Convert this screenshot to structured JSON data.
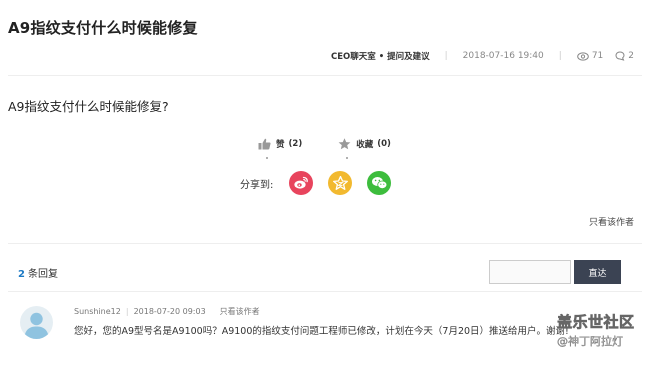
{
  "post": {
    "title": "A9指纹支付什么时候能修复",
    "category": "CEO聊天室 • 提问及建议",
    "datetime": "2018-07-16 19:40",
    "views": "71",
    "comments": "2",
    "question": "A9指纹支付什么时候能修复?"
  },
  "actions": {
    "like_label": "赞",
    "like_count": "(2)",
    "favorite_label": "收藏",
    "favorite_count": "(0)"
  },
  "share": {
    "label": "分享到:"
  },
  "only_author_label": "只看该作者",
  "replies": {
    "count": "2",
    "count_suffix": "条回复",
    "search_button": "直达",
    "search_value": ""
  },
  "reply": {
    "author": "Sunshine12",
    "datetime": "2018-07-20 09:03",
    "only_author": "只看该作者",
    "text": "您好，您的A9型号名是A9100吗？A9100的指纹支付问题工程师已修改，计划在今天（7月20日）推送给用户。谢谢!"
  },
  "watermark": {
    "line1": "盖乐世社区",
    "line2": "@神丁阿拉灯"
  },
  "colors": {
    "accent": "#1e7ac4",
    "button_dark": "#3b4353",
    "weibo": "#e8445d",
    "qzone": "#f2b92f",
    "wechat": "#3dbd3d"
  },
  "icons": {
    "views": "eye-icon",
    "comments": "speech-bubble-icon",
    "like": "thumbs-up-icon",
    "favorite": "star-icon",
    "weibo": "weibo-icon",
    "qzone": "qzone-star-icon",
    "wechat": "wechat-icon"
  }
}
